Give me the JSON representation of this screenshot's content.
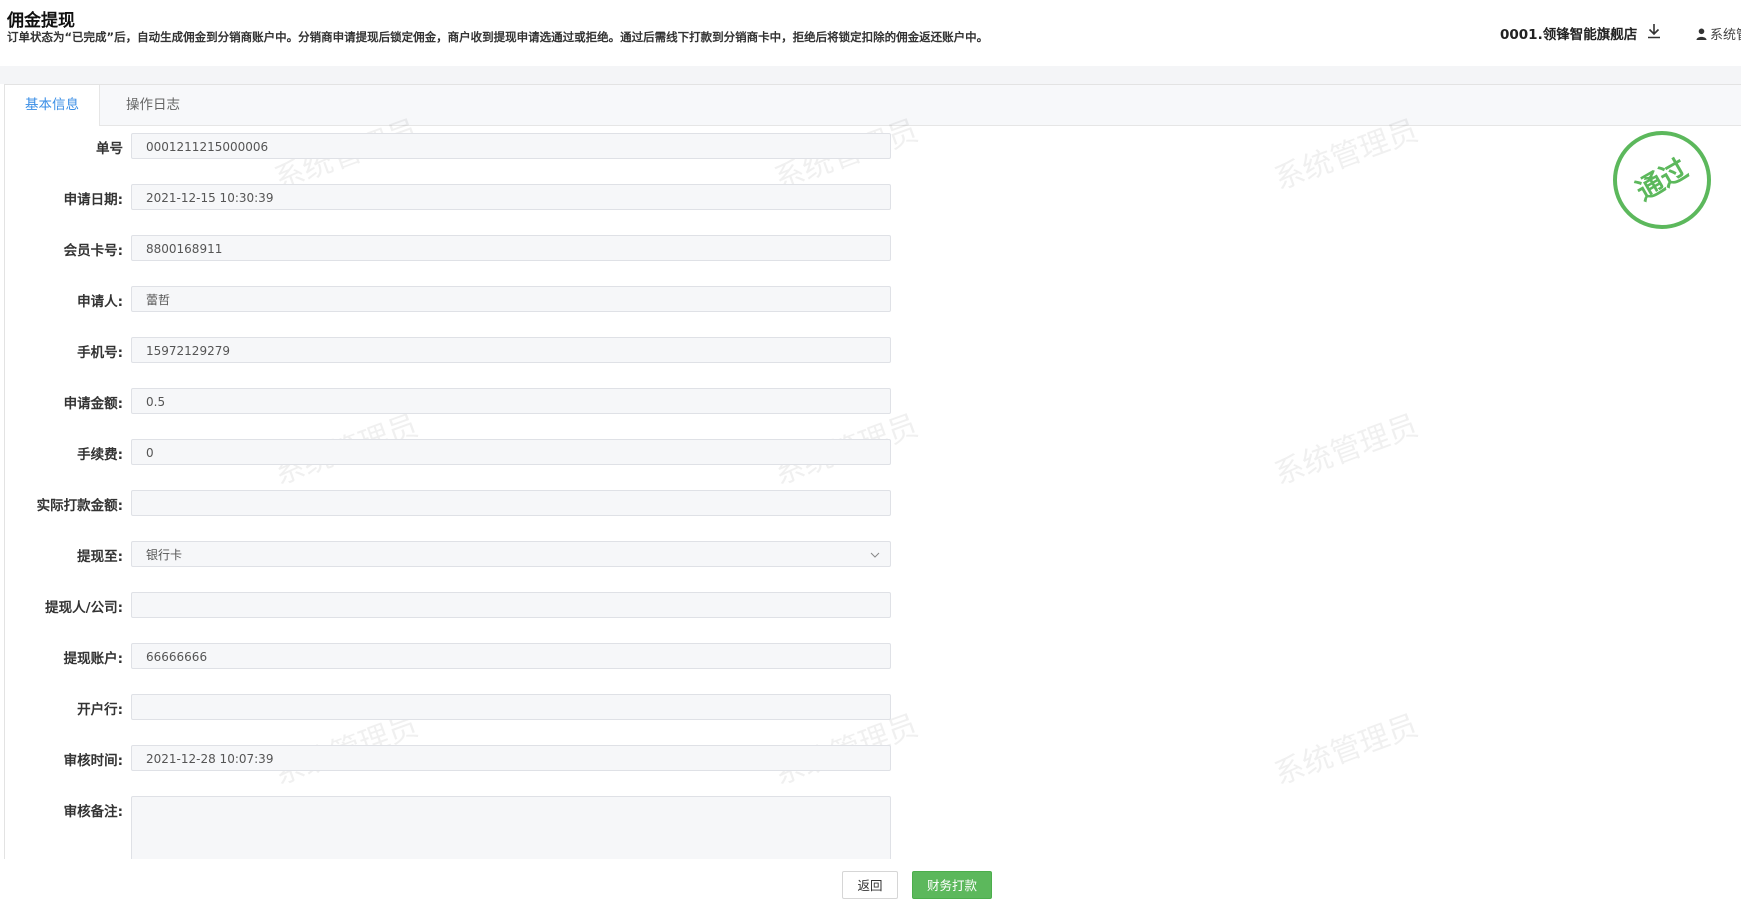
{
  "header": {
    "title": "佣金提现",
    "description": "订单状态为“已完成”后，自动生成佣金到分销商账户中。分销商申请提现后锁定佣金，商户收到提现申请选通过或拒绝。通过后需线下打款到分销商卡中，拒绝后将锁定扣除的佣金返还账户中。",
    "store_name": "0001.领锋智能旗舰店",
    "download_icon": "download-icon",
    "user_icon": "user-icon",
    "user_name": "系统管"
  },
  "tabs": [
    {
      "label": "基本信息",
      "active": true
    },
    {
      "label": "操作日志",
      "active": false
    }
  ],
  "form": {
    "order_no": {
      "label": "单号",
      "value": "0001211215000006"
    },
    "apply_date": {
      "label": "申请日期:",
      "value": "2021-12-15 10:30:39"
    },
    "member_card": {
      "label": "会员卡号:",
      "value": "8800168911"
    },
    "applicant": {
      "label": "申请人:",
      "value": "蕾哲"
    },
    "phone": {
      "label": "手机号:",
      "value": "15972129279"
    },
    "amount": {
      "label": "申请金额:",
      "value": "0.5"
    },
    "fee": {
      "label": "手续费:",
      "value": "0"
    },
    "actual_amount": {
      "label": "实际打款金额:",
      "value": ""
    },
    "withdraw_to": {
      "label": "提现至:",
      "value": "银行卡"
    },
    "withdraw_person": {
      "label": "提现人/公司:",
      "value": ""
    },
    "withdraw_account": {
      "label": "提现账户:",
      "value": "66666666"
    },
    "bank": {
      "label": "开户行:",
      "value": ""
    },
    "audit_time": {
      "label": "审核时间:",
      "value": "2021-12-28 10:07:39"
    },
    "audit_remark": {
      "label": "审核备注:",
      "value": ""
    }
  },
  "stamp": {
    "text": "通过",
    "color": "#5cb85c"
  },
  "watermark": "系统管理员",
  "buttons": {
    "back": "返回",
    "pay": "财务打款"
  },
  "colors": {
    "accent": "#3a8ee6",
    "success": "#5cb85c"
  }
}
